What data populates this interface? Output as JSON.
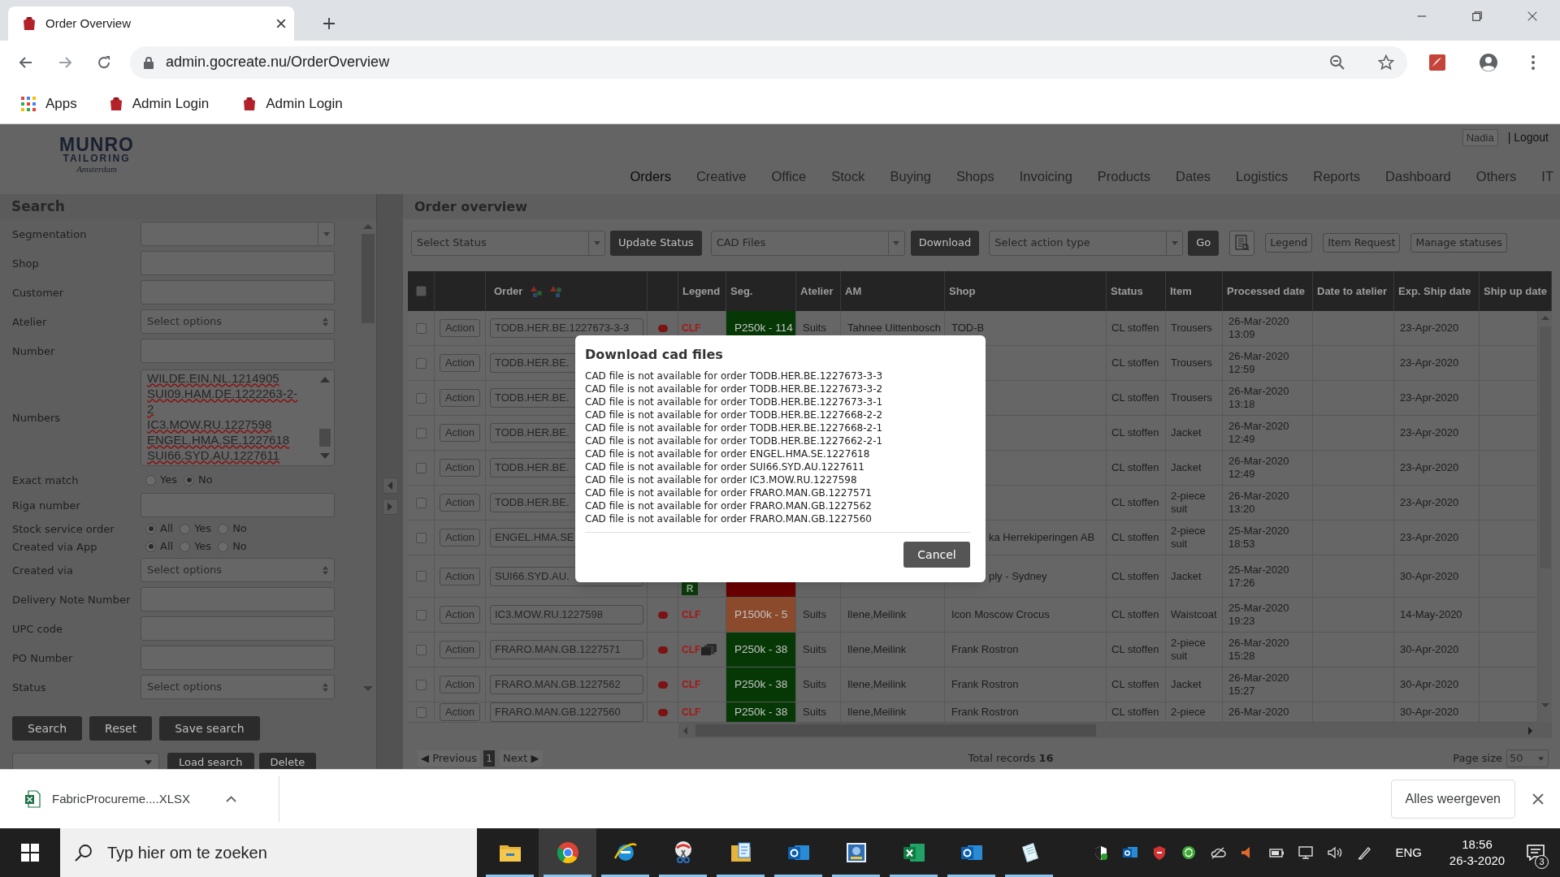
{
  "browser": {
    "tab_title": "Order Overview",
    "url": "admin.gocreate.nu/OrderOverview",
    "bookmarks": [
      "Apps",
      "Admin Login",
      "Admin Login"
    ]
  },
  "header": {
    "logo": {
      "name": "MUNRO",
      "sub": "TAILORING",
      "script": "Amsterdam"
    },
    "user": "Nadia",
    "logout": "| Logout",
    "nav": [
      {
        "label": "Orders",
        "selected": true
      },
      {
        "label": "Creative",
        "selected": false
      },
      {
        "label": "Office",
        "selected": false
      },
      {
        "label": "Stock",
        "selected": false
      },
      {
        "label": "Buying",
        "selected": false
      },
      {
        "label": "Shops",
        "selected": false
      },
      {
        "label": "Invoicing",
        "selected": false
      },
      {
        "label": "Products",
        "selected": false
      },
      {
        "label": "Dates",
        "selected": false
      },
      {
        "label": "Logistics",
        "selected": false
      },
      {
        "label": "Reports",
        "selected": false
      },
      {
        "label": "Dashboard",
        "selected": false
      },
      {
        "label": "Others",
        "selected": false
      },
      {
        "label": "IT",
        "selected": false
      }
    ]
  },
  "search_panel": {
    "title": "Search",
    "fields": [
      {
        "kind": "select",
        "label": "Segmentation"
      },
      {
        "kind": "text",
        "label": "Shop"
      },
      {
        "kind": "text",
        "label": "Customer"
      },
      {
        "kind": "multi",
        "label": "Atelier",
        "placeholder": "Select options"
      },
      {
        "kind": "text",
        "label": "Number"
      },
      {
        "kind": "textarea",
        "label": "Numbers",
        "lines": [
          "WILDE.EIN.NL.1214905",
          "SUI09.HAM.DE.1222263-2-",
          "2",
          "IC3.MOW.RU.1227598",
          "ENGEL.HMA.SE.1227618",
          "SUI66.SYD.AU.1227611"
        ]
      },
      {
        "kind": "radio",
        "label": "Exact match",
        "options": [
          {
            "label": "Yes",
            "selected": false
          },
          {
            "label": "No",
            "selected": true
          }
        ]
      },
      {
        "kind": "text",
        "label": "Riga number"
      },
      {
        "kind": "radio",
        "label": "Stock service order",
        "options": [
          {
            "label": "All",
            "selected": true
          },
          {
            "label": "Yes",
            "selected": false
          },
          {
            "label": "No",
            "selected": false
          }
        ]
      },
      {
        "kind": "radio",
        "label": "Created via App",
        "options": [
          {
            "label": "All",
            "selected": true
          },
          {
            "label": "Yes",
            "selected": false
          },
          {
            "label": "No",
            "selected": false
          }
        ]
      },
      {
        "kind": "multi",
        "label": "Created via",
        "placeholder": "Select options"
      },
      {
        "kind": "text",
        "label": "Delivery Note Number"
      },
      {
        "kind": "text",
        "label": "UPC code"
      },
      {
        "kind": "text",
        "label": "PO Number"
      },
      {
        "kind": "multi",
        "label": "Status",
        "placeholder": "Select options"
      }
    ],
    "buttons": [
      "Search",
      "Reset",
      "Save search"
    ],
    "saved_buttons": [
      "Load search",
      "Delete"
    ]
  },
  "title": "Order overview",
  "toolbar": {
    "status_select": "Select Status",
    "update_button": "Update Status",
    "cad_select": "CAD Files",
    "download_button": "Download",
    "action_select": "Select action type",
    "go_button": "Go",
    "buttons": [
      "Legend",
      "Item Request",
      "Manage statuses"
    ]
  },
  "table": {
    "header_checked": false,
    "columns": [
      "Order",
      "Legend",
      "Seg.",
      "Atelier",
      "AM",
      "Shop",
      "Status",
      "Item",
      "Processed date",
      "Date to atelier",
      "Exp. Ship date",
      "Ship up date"
    ],
    "rows": [
      {
        "checked": false,
        "action": "Action",
        "order": "TODB.HER.BE.1227673-3-3",
        "dot": true,
        "legend": {
          "kind": "tag",
          "text": "CLF"
        },
        "seg": {
          "text": "P250k - 114",
          "color": "#063806"
        },
        "atelier": "Suits",
        "am": "Tahnee Uittenbosch",
        "shop": "TOD-B",
        "status": "CL stoffen",
        "item": "Trousers",
        "processed": "26-Mar-2020 13:09",
        "exp_ship": "23-Apr-2020"
      },
      {
        "checked": false,
        "action": "Action",
        "order": "TODB.HER.BE.",
        "status": "CL stoffen",
        "item": "Trousers",
        "processed": "26-Mar-2020 12:59",
        "exp_ship": "23-Apr-2020"
      },
      {
        "checked": false,
        "action": "Action",
        "order": "TODB.HER.BE.",
        "status": "CL stoffen",
        "item": "Trousers",
        "processed": "26-Mar-2020 13:18",
        "exp_ship": "23-Apr-2020"
      },
      {
        "checked": false,
        "action": "Action",
        "order": "TODB.HER.BE.",
        "status": "CL stoffen",
        "item": "Jacket",
        "processed": "26-Mar-2020 12:49",
        "exp_ship": "23-Apr-2020"
      },
      {
        "checked": false,
        "action": "Action",
        "order": "TODB.HER.BE.",
        "status": "CL stoffen",
        "item": "Jacket",
        "processed": "26-Mar-2020 12:49",
        "exp_ship": "23-Apr-2020"
      },
      {
        "checked": false,
        "action": "Action",
        "order": "TODB.HER.BE.",
        "status": "CL stoffen",
        "item": "2-piece suit",
        "processed": "26-Mar-2020 13:20",
        "exp_ship": "23-Apr-2020"
      },
      {
        "checked": false,
        "action": "Action",
        "order": "ENGEL.HMA.SE",
        "shop": "ka Herrekiperingen AB",
        "status": "CL stoffen",
        "item": "2-piece suit",
        "processed": "25-Mar-2020 18:53",
        "exp_ship": "23-Apr-2020",
        "under_dialog": true
      },
      {
        "checked": false,
        "action": "Action",
        "order": "SUI66.SYD.AU.",
        "legend": {
          "kind": "badge",
          "text": "R"
        },
        "seg": {
          "color": "#6b0000"
        },
        "shop": "ply - Sydney",
        "status": "CL stoffen",
        "item": "Jacket",
        "processed": "25-Mar-2020 17:26",
        "exp_ship": "30-Apr-2020",
        "under_dialog": true
      },
      {
        "checked": false,
        "action": "Action",
        "order": "IC3.MOW.RU.1227598",
        "dot": true,
        "legend": {
          "kind": "tag",
          "text": "CLF"
        },
        "seg": {
          "text": "P1500k - 5",
          "color": "#8a4a2b"
        },
        "atelier": "Suits",
        "am": "Ilene,Meilink",
        "shop": "Icon Moscow Crocus",
        "status": "CL stoffen",
        "item": "Waistcoat",
        "processed": "25-Mar-2020 19:23",
        "exp_ship": "14-May-2020"
      },
      {
        "checked": false,
        "action": "Action",
        "order": "FRARO.MAN.GB.1227571",
        "dot": true,
        "legend": {
          "kind": "tag",
          "text": "CLF",
          "attachment": true
        },
        "seg": {
          "text": "P250k - 38",
          "color": "#063806"
        },
        "atelier": "Suits",
        "am": "Ilene,Meilink",
        "shop": "Frank Rostron",
        "status": "CL stoffen",
        "item": "2-piece suit",
        "processed": "26-Mar-2020 15:28",
        "exp_ship": "30-Apr-2020"
      },
      {
        "checked": false,
        "action": "Action",
        "order": "FRARO.MAN.GB.1227562",
        "dot": true,
        "legend": {
          "kind": "tag",
          "text": "CLF"
        },
        "seg": {
          "text": "P250k - 38",
          "color": "#063806"
        },
        "atelier": "Suits",
        "am": "Ilene,Meilink",
        "shop": "Frank Rostron",
        "status": "CL stoffen",
        "item": "Jacket",
        "processed": "26-Mar-2020 15:27",
        "exp_ship": "30-Apr-2020"
      },
      {
        "checked": false,
        "action": "Action",
        "order": "FRARO.MAN.GB.1227560",
        "dot": true,
        "legend": {
          "kind": "tag",
          "text": "CLF"
        },
        "seg": {
          "text": "P250k - 38",
          "color": "#063806"
        },
        "atelier": "Suits",
        "am": "Ilene,Meilink",
        "shop": "Frank Rostron",
        "status": "CL stoffen",
        "item": "2-piece",
        "processed": "26-Mar-2020",
        "exp_ship": "30-Apr-2020"
      }
    ]
  },
  "pager": {
    "previous": "◀ Previous",
    "page": "1",
    "next": "Next ▶",
    "total": "Total records **16**",
    "page_size_label": "Page size",
    "page_size": "50"
  },
  "dialog": {
    "title": "Download cad files",
    "lines": [
      "CAD file is not available for order TODB.HER.BE.1227673-3-3",
      "CAD file is not available for order TODB.HER.BE.1227673-3-2",
      "CAD file is not available for order TODB.HER.BE.1227673-3-1",
      "CAD file is not available for order TODB.HER.BE.1227668-2-2",
      "CAD file is not available for order TODB.HER.BE.1227668-2-1",
      "CAD file is not available for order TODB.HER.BE.1227662-2-1",
      "CAD file is not available for order ENGEL.HMA.SE.1227618",
      "CAD file is not available for order SUI66.SYD.AU.1227611",
      "CAD file is not available for order IC3.MOW.RU.1227598",
      "CAD file is not available for order FRARO.MAN.GB.1227571",
      "CAD file is not available for order FRARO.MAN.GB.1227562",
      "CAD file is not available for order FRARO.MAN.GB.1227560"
    ],
    "cancel": "Cancel"
  },
  "download_bar": {
    "file": "FabricProcureme....XLSX",
    "show_all": "Alles weergeven"
  },
  "taskbar": {
    "search_placeholder": "Typ hier om te zoeken",
    "apps": [
      {
        "kind": "folder",
        "selected": false,
        "running": true
      },
      {
        "kind": "chrome",
        "selected": true,
        "running": true
      },
      {
        "kind": "ie",
        "selected": false,
        "running": true
      },
      {
        "kind": "snip",
        "selected": false,
        "running": true
      },
      {
        "kind": "filefolder",
        "selected": false,
        "running": true
      },
      {
        "kind": "outlook",
        "selected": false,
        "running": true
      },
      {
        "kind": "tile",
        "selected": false,
        "running": true
      },
      {
        "kind": "excel",
        "selected": false,
        "running": true
      },
      {
        "kind": "outlook",
        "selected": false,
        "running": true
      },
      {
        "kind": "notepad",
        "selected": false,
        "running": true
      }
    ],
    "language": "ENG",
    "time": "18:56",
    "date": "26-3-2020",
    "notifications": "3"
  }
}
